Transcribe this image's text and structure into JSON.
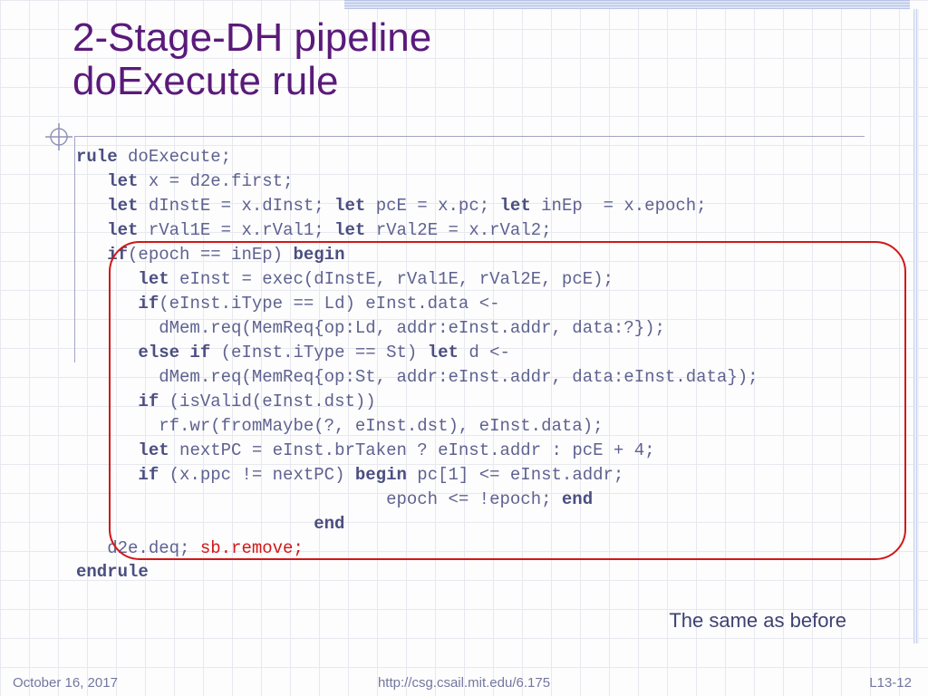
{
  "title": {
    "line1": "2-Stage-DH pipeline",
    "line2": "doExecute rule"
  },
  "code": {
    "l1_kw": "rule",
    "l1_rest": " doExecute;",
    "l2_kw": "let",
    "l2_rest": " x = d2e.first;",
    "l3_kw1": "let",
    "l3_a": " dInstE = x.dInst; ",
    "l3_kw2": "let",
    "l3_b": " pcE = x.pc; ",
    "l3_kw3": "let",
    "l3_c": " inEp  = x.epoch;",
    "l4_kw1": "let",
    "l4_a": " rVal1E = x.rVal1; ",
    "l4_kw2": "let",
    "l4_b": " rVal2E = x.rVal2;",
    "l5_kw1": "if",
    "l5_a": "(epoch == inEp) ",
    "l5_kw2": "begin",
    "l6_kw": "let",
    "l6_rest": " eInst = exec(dInstE, rVal1E, rVal2E, pcE);",
    "l7_kw": "if",
    "l7_rest": "(eInst.iType == Ld) eInst.data <-",
    "l8": "dMem.req(MemReq{op:Ld, addr:eInst.addr, data:?});",
    "l9_kw1": "else if",
    "l9_a": " (eInst.iType == St) ",
    "l9_kw2": "let",
    "l9_b": " d <-",
    "l10": "dMem.req(MemReq{op:St, addr:eInst.addr, data:eInst.data});",
    "l11_kw": "if",
    "l11_rest": " (isValid(eInst.dst))",
    "l12": "rf.wr(fromMaybe(?, eInst.dst), eInst.data);",
    "l13_kw": "let",
    "l13_rest": " nextPC = eInst.brTaken ? eInst.addr : pcE + 4;",
    "l14_kw1": "if",
    "l14_a": " (x.ppc != nextPC) ",
    "l14_kw2": "begin",
    "l14_b": " pc[1] <= eInst.addr;",
    "l15_a": "epoch <= !epoch; ",
    "l15_kw": "end",
    "l16_kw": "end",
    "l17_a": "d2e.deq; ",
    "l17_red": "sb.remove;",
    "l18_kw": "endrule"
  },
  "note": "The same as before",
  "footer": {
    "date": "October 16, 2017",
    "url": "http://csg.csail.mit.edu/6.175",
    "page": "L13-12"
  }
}
